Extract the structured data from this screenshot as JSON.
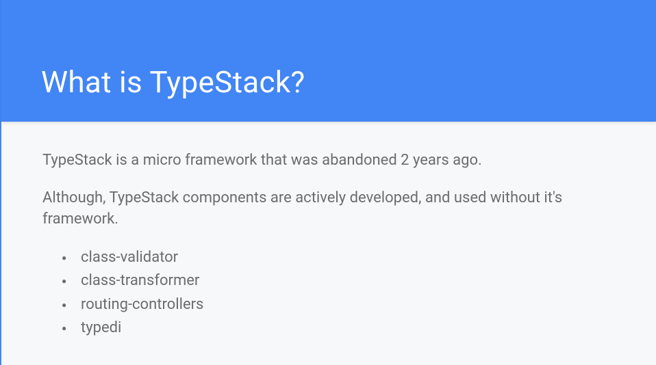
{
  "slide": {
    "title": "What is TypeStack?",
    "paragraph1": "TypeStack is a micro framework that was abandoned 2 years ago.",
    "paragraph2": "Although, TypeStack components are actively developed, and used without it's framework.",
    "bullets": [
      "class-validator",
      "class-transformer",
      "routing-controllers",
      "typedi"
    ]
  }
}
